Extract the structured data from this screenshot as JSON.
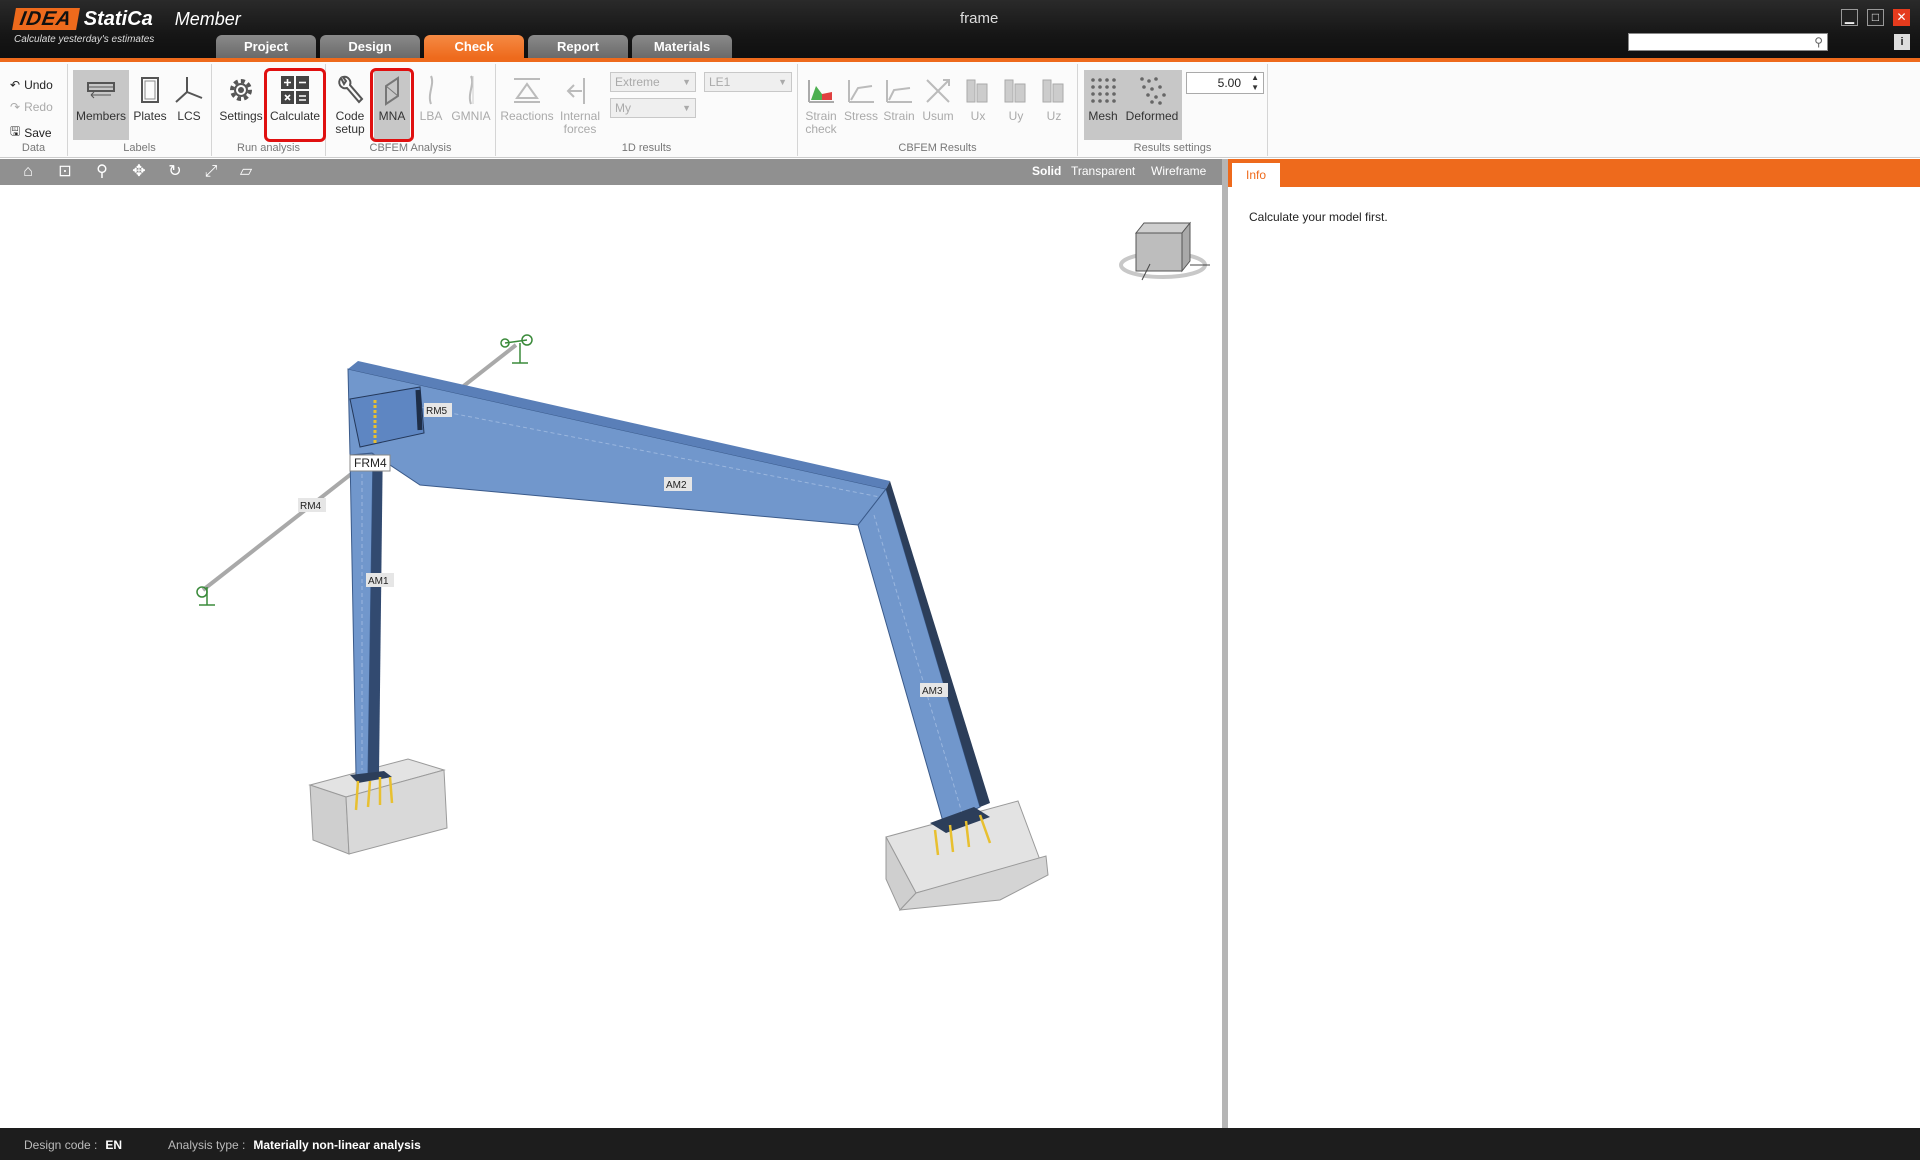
{
  "app": {
    "logo_brand": "IDEA",
    "logo_product_name": "StatiCa",
    "module": "Member",
    "tagline": "Calculate yesterday's estimates",
    "window_title": "frame"
  },
  "main_tabs": [
    {
      "label": "Project"
    },
    {
      "label": "Design"
    },
    {
      "label": "Check",
      "active": true
    },
    {
      "label": "Report"
    },
    {
      "label": "Materials"
    }
  ],
  "ribbon": {
    "data": {
      "undo": "Undo",
      "redo": "Redo",
      "save": "Save",
      "group": "Data"
    },
    "labels": {
      "members": "Members",
      "plates": "Plates",
      "lcs": "LCS",
      "group": "Labels"
    },
    "run_analysis": {
      "settings": "Settings",
      "calculate": "Calculate",
      "group": "Run analysis"
    },
    "cbfem_analysis": {
      "code_setup_1": "Code",
      "code_setup_2": "setup",
      "mna": "MNA",
      "lba": "LBA",
      "gmnia": "GMNIA",
      "group": "CBFEM Analysis"
    },
    "results_1d": {
      "reactions": "Reactions",
      "internal_1": "Internal",
      "internal_2": "forces",
      "dd_extreme": "Extreme",
      "dd_my": "My",
      "dd_le": "LE1",
      "group": "1D results"
    },
    "cbfem_results": {
      "strain_check_1": "Strain",
      "strain_check_2": "check",
      "stress": "Stress",
      "strain": "Strain",
      "usum": "Usum",
      "ux": "Ux",
      "uy": "Uy",
      "uz": "Uz",
      "group": "CBFEM Results"
    },
    "results_settings": {
      "mesh": "Mesh",
      "deformed": "Deformed",
      "mesh_value": "5.00",
      "group": "Results settings"
    }
  },
  "viewport": {
    "render_modes": [
      "Solid",
      "Transparent",
      "Wireframe"
    ],
    "active_render_mode": "Solid",
    "member_labels": {
      "rm5": "RM5",
      "frm4": "FRM4",
      "rm4": "RM4",
      "am1": "AM1",
      "am2": "AM2",
      "am3": "AM3"
    }
  },
  "info_panel": {
    "tab": "Info",
    "message": "Calculate your model first."
  },
  "status": {
    "design_code_label": "Design code :",
    "design_code_value": "EN",
    "analysis_type_label": "Analysis type :",
    "analysis_type_value": "Materially non-linear analysis"
  },
  "colors": {
    "accent": "#ee6a1c",
    "member_blue": "#7197cc",
    "highlight_red": "#e01010"
  }
}
